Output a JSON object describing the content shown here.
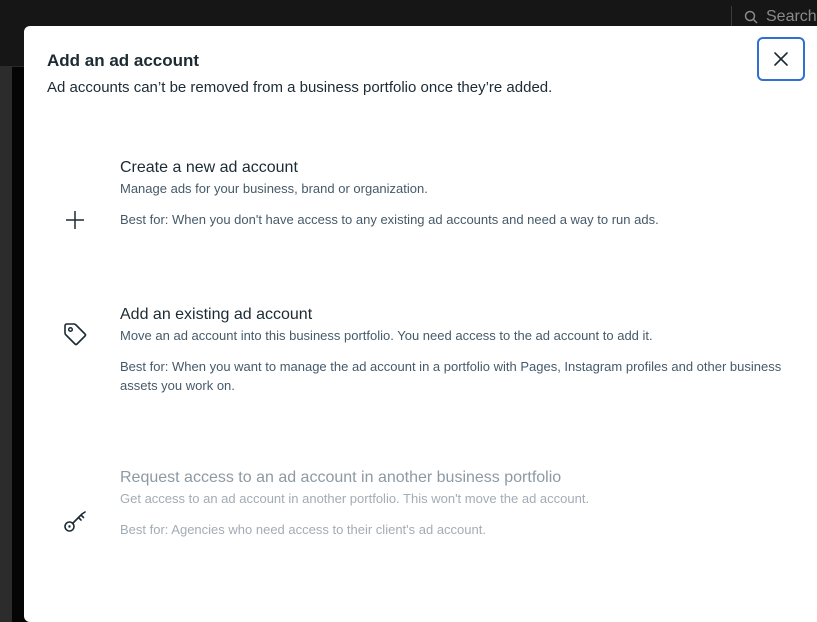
{
  "background": {
    "search_placeholder": "Search"
  },
  "dialog": {
    "title": "Add an ad account",
    "subtitle": "Ad accounts can’t be removed from a business portfolio once they’re added.",
    "close_icon": "close-icon"
  },
  "options": [
    {
      "icon": "plus-icon",
      "title": "Create a new ad account",
      "description": "Manage ads for your business, brand or organization.",
      "best_for": "Best for: When you don't have access to any existing ad accounts and need a way to run ads.",
      "enabled": true
    },
    {
      "icon": "tag-icon",
      "title": "Add an existing ad account",
      "description": "Move an ad account into this business portfolio. You need access to the ad account to add it.",
      "best_for": "Best for: When you want to manage the ad account in a portfolio with Pages, Instagram profiles and other business assets you work on.",
      "enabled": true
    },
    {
      "icon": "key-icon",
      "title": "Request access to an ad account in another business portfolio",
      "description": "Get access to an ad account in another portfolio. This won't move the ad account.",
      "best_for": "Best for: Agencies who need access to their client's ad account.",
      "enabled": false
    }
  ],
  "colors": {
    "focus_ring": "#2f6fd6",
    "text_primary": "#1c2b33",
    "text_secondary": "#465a69",
    "text_disabled": "#a2acb4"
  }
}
